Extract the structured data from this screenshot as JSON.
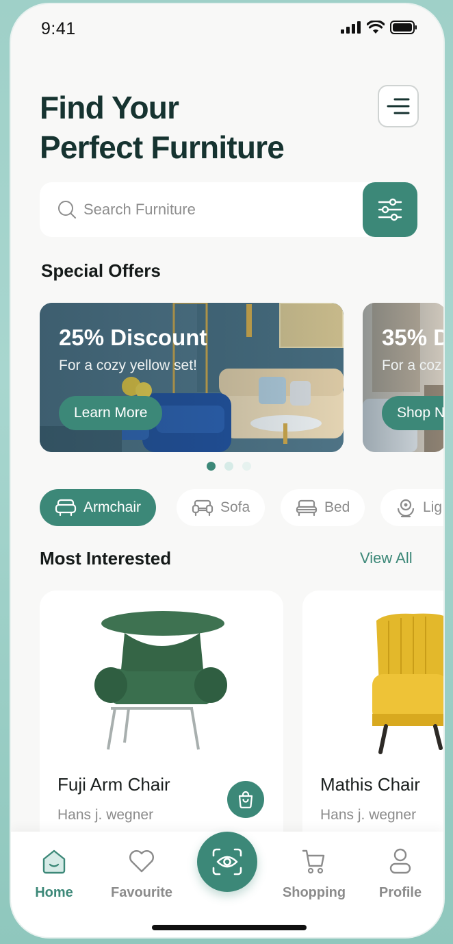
{
  "status_bar": {
    "time": "9:41"
  },
  "header": {
    "title_line1": "Find Your",
    "title_line2": "Perfect Furniture",
    "menu_icon": "menu-lines-icon"
  },
  "search": {
    "placeholder": "Search Furniture",
    "value": ""
  },
  "special_offers": {
    "title": "Special Offers",
    "cards": [
      {
        "title": "25% Discount",
        "subtitle": "For a cozy yellow set!",
        "button": "Learn More"
      },
      {
        "title": "35% D",
        "subtitle": "For a coz",
        "button": "Shop N"
      }
    ],
    "active_page": 1,
    "page_count": 3
  },
  "categories": [
    {
      "label": "Armchair",
      "icon": "armchair-icon",
      "active": true
    },
    {
      "label": "Sofa",
      "icon": "sofa-icon",
      "active": false
    },
    {
      "label": "Bed",
      "icon": "bed-icon",
      "active": false
    },
    {
      "label": "Lig",
      "icon": "lamp-icon",
      "active": false
    }
  ],
  "most_interested": {
    "title": "Most Interested",
    "view_all": "View All",
    "products": [
      {
        "name": "Fuji Arm Chair",
        "maker": "Hans j. wegner"
      },
      {
        "name": "Mathis Chair",
        "maker": "Hans j. wegner"
      }
    ]
  },
  "bottom_nav": {
    "items": [
      {
        "label": "Home",
        "icon": "home-icon",
        "active": true
      },
      {
        "label": "Favourite",
        "icon": "heart-icon",
        "active": false
      },
      {
        "label": "Shopping",
        "icon": "cart-icon",
        "active": false
      },
      {
        "label": "Profile",
        "icon": "user-icon",
        "active": false
      }
    ],
    "center_icon": "scan-eye-icon"
  },
  "colors": {
    "accent": "#3c8878",
    "title": "#163330",
    "background": "#f8f8f7"
  }
}
